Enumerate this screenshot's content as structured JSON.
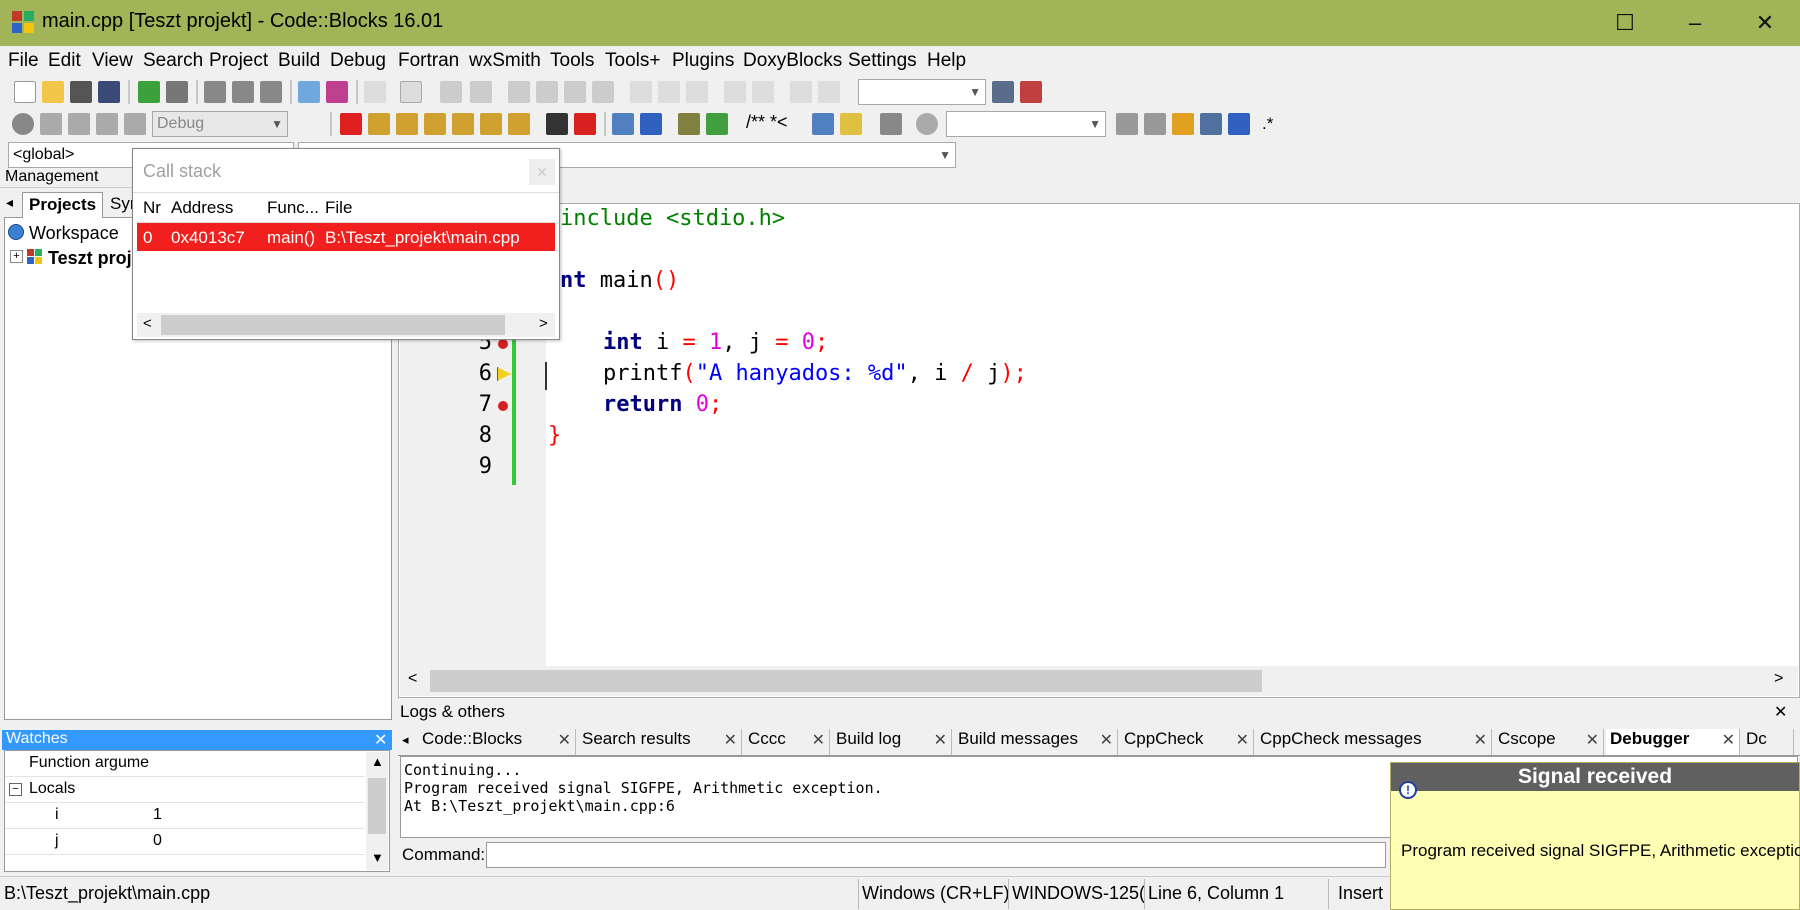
{
  "window": {
    "title": "main.cpp [Teszt projekt] - Code::Blocks 16.01",
    "minimize": "–",
    "maximize": "☐",
    "close": "✕"
  },
  "menu": [
    "File",
    "Edit",
    "View",
    "Search",
    "Project",
    "Build",
    "Debug",
    "Fortran",
    "wxSmith",
    "Tools",
    "Tools+",
    "Plugins",
    "DoxyBlocks",
    "Settings",
    "Help"
  ],
  "toolbar": {
    "build_target": "Debug",
    "doxy_comment": "/** *<",
    "regex_glyph": ".*"
  },
  "scope": {
    "global": "<global>"
  },
  "management": {
    "title": "Management",
    "tabs": [
      "Projects",
      "Sym"
    ],
    "workspace": "Workspace",
    "project": "Teszt proj"
  },
  "callstack": {
    "title": "Call stack",
    "columns": [
      "Nr",
      "Address",
      "Func...",
      "File"
    ],
    "rows": [
      {
        "nr": "0",
        "address": "0x4013c7",
        "func": "main()",
        "file": "B:\\Teszt_projekt\\main.cpp"
      }
    ]
  },
  "editor": {
    "lines": [
      "5",
      "6",
      "7",
      "8",
      "9"
    ],
    "code": {
      "l1_include": "include <stdio.h>",
      "l3_kw": "nt",
      "l3_rest": " main",
      "l3_parens": "()",
      "l5_kw": "int",
      "l5_i": " i ",
      "l5_eq1": "=",
      "l5_one": " 1",
      "l5_comma": ", j ",
      "l5_eq2": "=",
      "l5_zero": " 0",
      "l5_semi": ";",
      "l6_fn": "printf",
      "l6_paren_open": "(",
      "l6_str": "\"A hanyados: %d\"",
      "l6_args": ", i ",
      "l6_div": "/",
      "l6_j": " j",
      "l6_close": ");",
      "l7_kw": "return",
      "l7_zero": " 0",
      "l7_semi": ";",
      "l8_brace": "}"
    }
  },
  "logs": {
    "title": "Logs & others",
    "tabs": [
      "Code::Blocks",
      "Search results",
      "Cccc",
      "Build log",
      "Build messages",
      "CppCheck",
      "CppCheck messages",
      "Cscope",
      "Debugger",
      "Dc"
    ],
    "active_tab": "Debugger",
    "lines": [
      "Continuing...",
      "Program received signal SIGFPE, Arithmetic exception.",
      "At B:\\Teszt_projekt\\main.cpp:6"
    ],
    "command_label": "Command:"
  },
  "watches": {
    "title": "Watches",
    "rows": [
      {
        "name": "Function argume",
        "value": ""
      },
      {
        "name": "Locals",
        "value": ""
      },
      {
        "name": "i",
        "value": "1"
      },
      {
        "name": "j",
        "value": "0"
      }
    ]
  },
  "status": {
    "file": "B:\\Teszt_projekt\\main.cpp",
    "eol": "Windows (CR+LF)",
    "encoding": "WINDOWS-125(",
    "position": "Line 6, Column 1",
    "mode": "Insert"
  },
  "signal": {
    "title": "Signal received",
    "message": "Program received signal SIGFPE, Arithmetic exception."
  }
}
